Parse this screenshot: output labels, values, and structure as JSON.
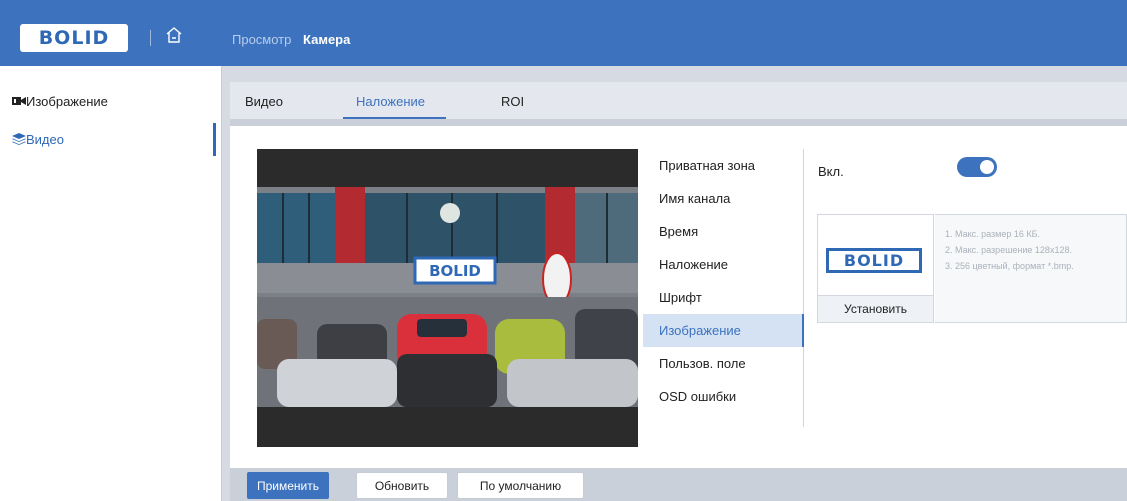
{
  "header": {
    "logo_text": "BOLID",
    "nav": [
      "Просмотр",
      "Камера"
    ],
    "active_nav": "Камера",
    "brand_color": "#3c72be"
  },
  "sidebar": {
    "items": [
      {
        "label": "Изображение",
        "icon": "camera-icon"
      },
      {
        "label": "Видео",
        "icon": "layers-icon",
        "active": true
      }
    ]
  },
  "tabs": {
    "items": [
      "Видео",
      "Наложение",
      "ROI"
    ],
    "active": "Наложение"
  },
  "preview": {
    "overlay_logo_text": "BOLID"
  },
  "osd_menu": {
    "items": [
      "Приватная зона",
      "Имя канала",
      "Время",
      "Наложение",
      "Шрифт",
      "Изображение",
      "Пользов. поле",
      "OSD ошибки"
    ],
    "active": "Изображение"
  },
  "settings": {
    "enable_label": "Вкл.",
    "enabled": true,
    "image_logo_text": "BOLID",
    "install_label": "Установить",
    "hints": [
      "1. Макс. размер 16 КБ.",
      "2. Макс. разрешение 128x128.",
      "3. 256 цветный, формат *.bmp."
    ]
  },
  "actions": {
    "apply_label": "Применить",
    "refresh_label": "Обновить",
    "default_label": "По умолчанию"
  }
}
